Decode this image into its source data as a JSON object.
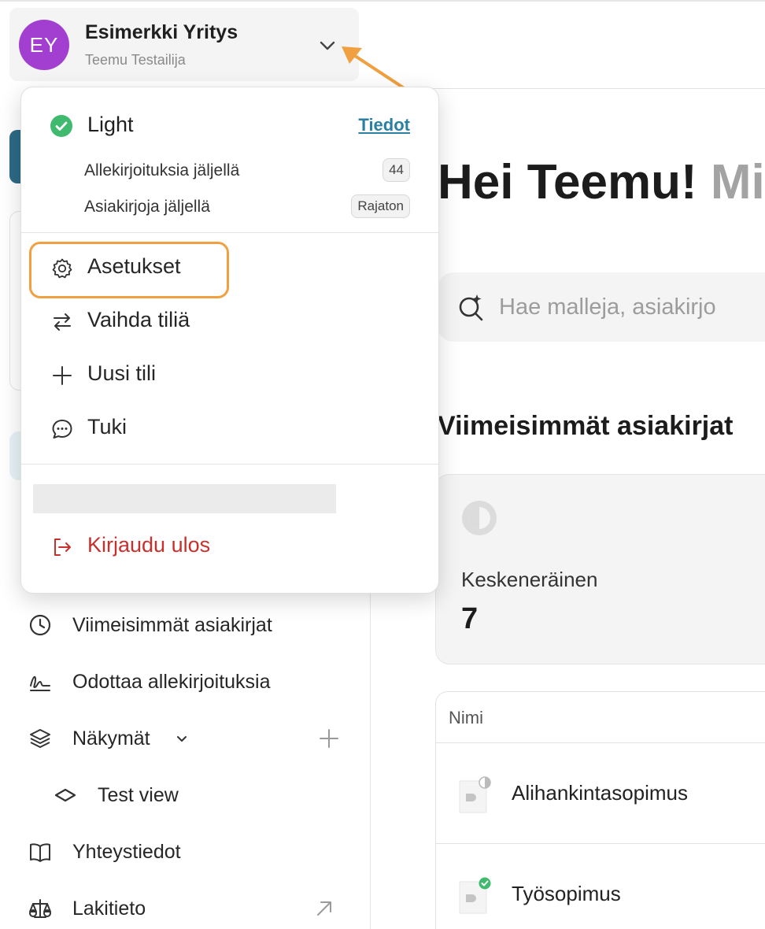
{
  "account": {
    "initials": "EY",
    "company": "Esimerkki Yritys",
    "user": "Teemu Testailija",
    "avatar_color": "#a23fd0"
  },
  "dropdown": {
    "plan": {
      "name": "Light",
      "details_link": "Tiedot",
      "status_color": "#3fba6e"
    },
    "quotas": [
      {
        "label": "Allekirjoituksia jäljellä",
        "value": "44"
      },
      {
        "label": "Asiakirjoja jäljellä",
        "value": "Rajaton"
      }
    ],
    "menu": {
      "settings": "Asetukset",
      "switch_account": "Vaihda tiliä",
      "new_account": "Uusi tili",
      "support": "Tuki",
      "logout": "Kirjaudu ulos"
    },
    "logout_color": "#c9302c",
    "highlight_color": "#f0a040"
  },
  "sidebar": {
    "recent": "Viimeisimmät asiakirjat",
    "awaiting_signatures": "Odottaa allekirjoituksia",
    "views": "Näkymät",
    "test_view": "Test view",
    "contacts": "Yhteystiedot",
    "legal": "Lakitieto"
  },
  "main": {
    "greeting": "Hei Teemu!",
    "greeting_continued": "Mit",
    "search_placeholder": "Hae malleja, asiakirjo",
    "section_title": "Viimeisimmät asiakirjat",
    "stat": {
      "label": "Keskeneräinen",
      "value": "7"
    },
    "table": {
      "header": "Nimi",
      "rows": [
        {
          "name": "Alihankintasopimus",
          "status": "in-progress"
        },
        {
          "name": "Työsopimus",
          "status": "completed"
        }
      ]
    }
  }
}
